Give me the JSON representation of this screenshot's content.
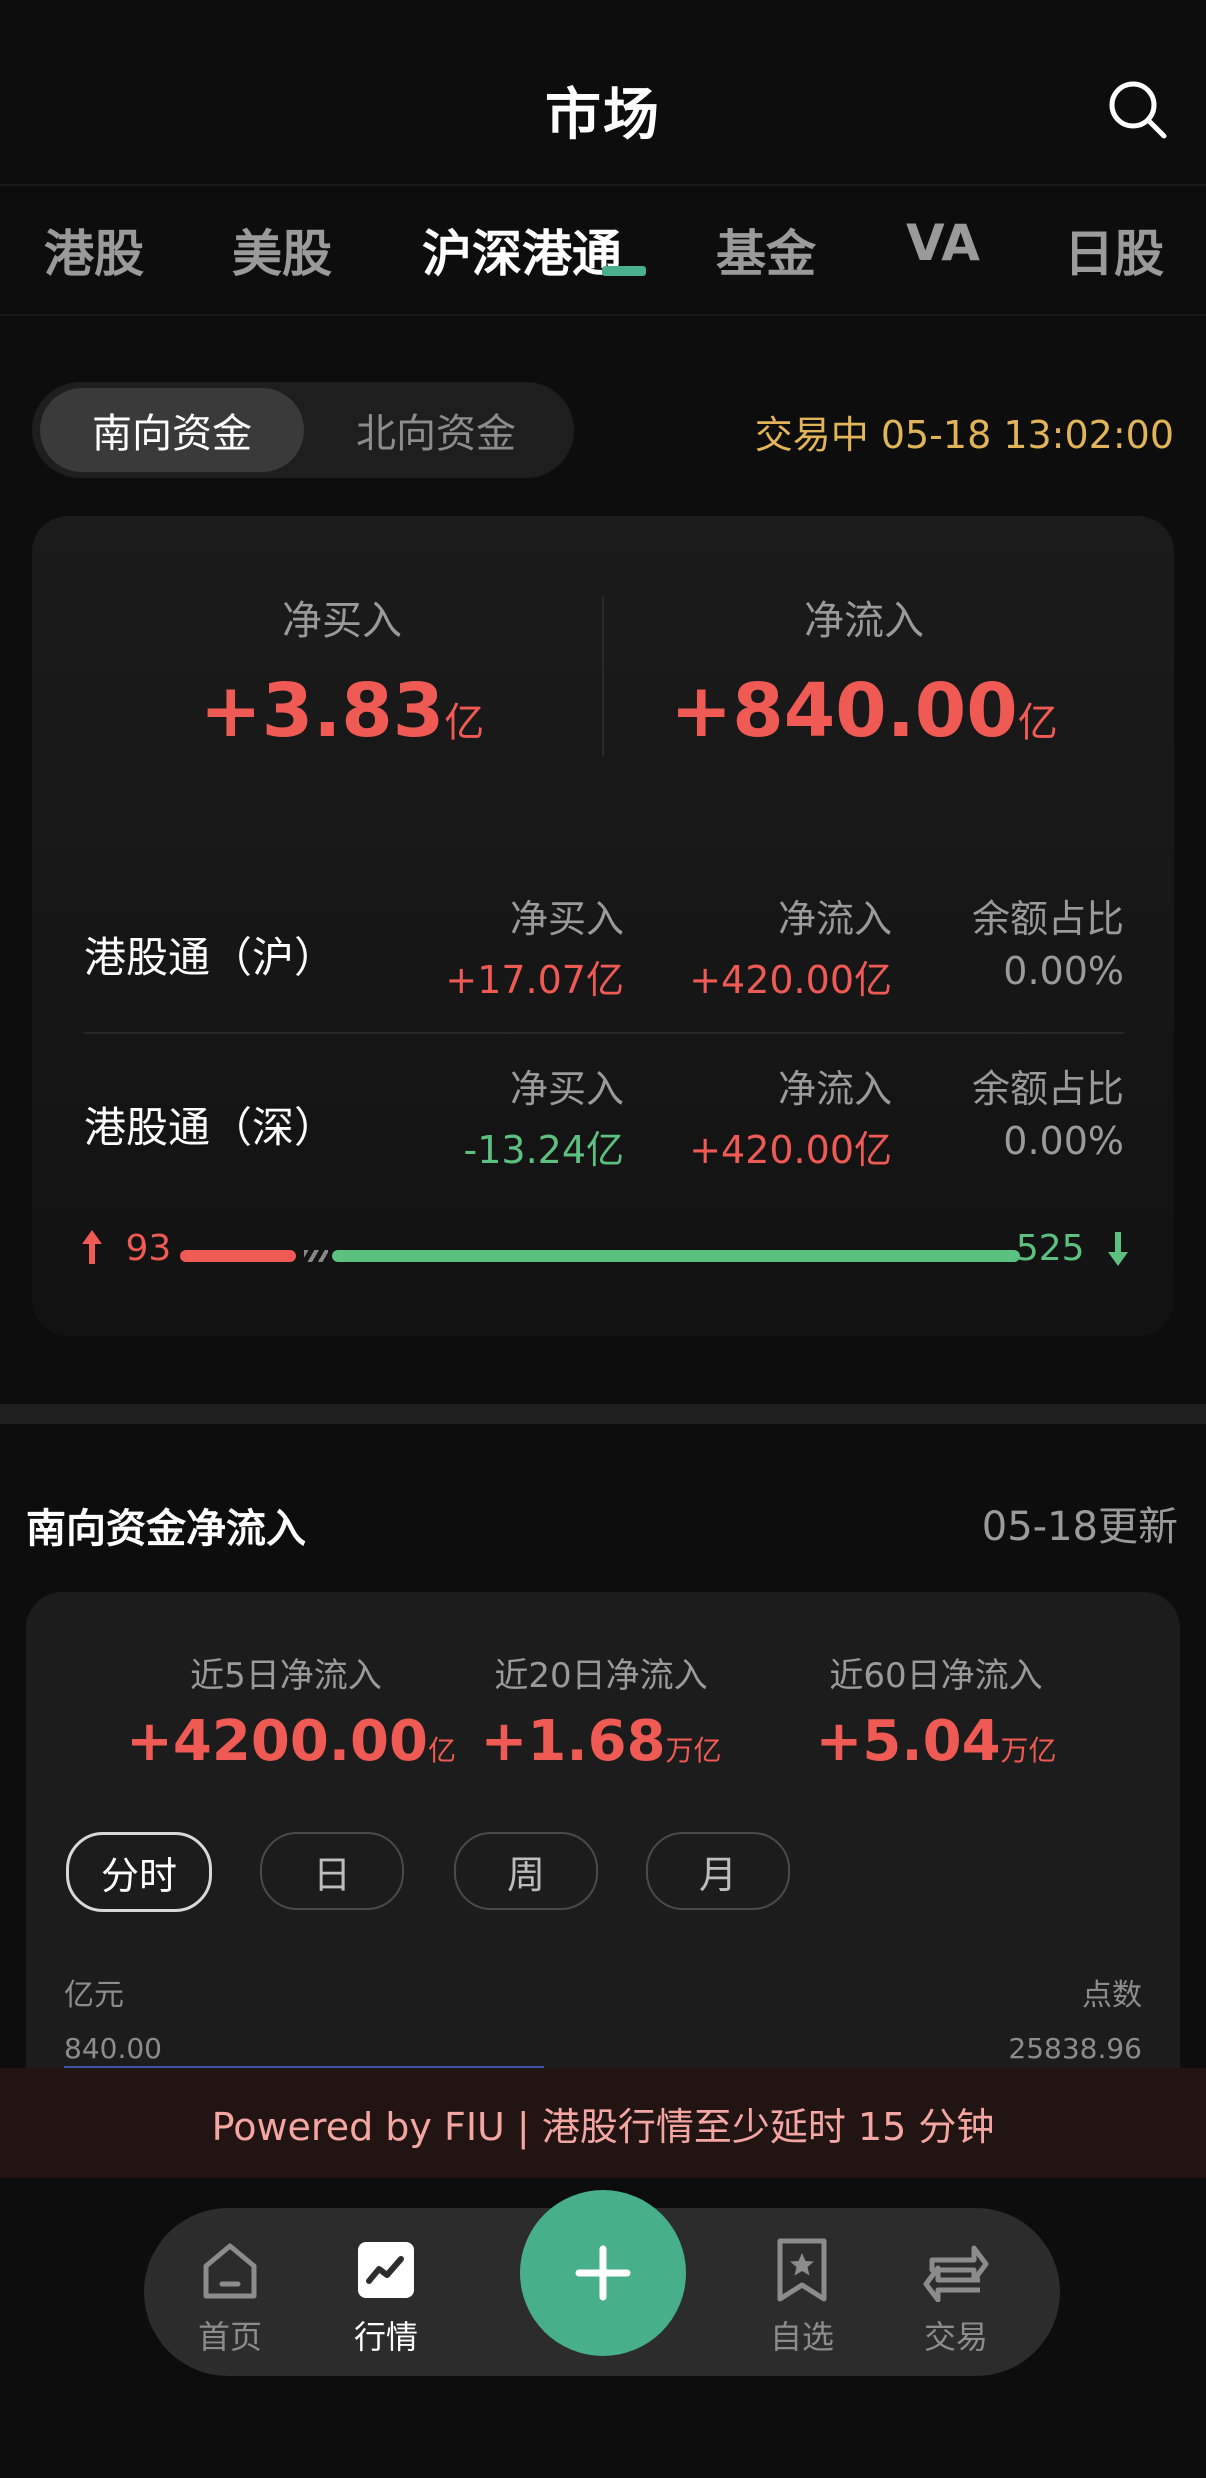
{
  "header": {
    "title": "市场"
  },
  "tabs": [
    {
      "label": "港股",
      "active": false
    },
    {
      "label": "美股",
      "active": false
    },
    {
      "label": "沪深港通",
      "active": true
    },
    {
      "label": "基金",
      "active": false
    },
    {
      "label": "VA",
      "active": false
    },
    {
      "label": "日股",
      "active": false
    }
  ],
  "segmented": {
    "options": [
      "南向资金",
      "北向资金"
    ],
    "selected": "南向资金"
  },
  "status": "交易中 05-18 13:02:00",
  "summary": {
    "net_buy": {
      "label": "净买入",
      "value": "+3.83",
      "unit": "亿"
    },
    "net_inflow": {
      "label": "净流入",
      "value": "+840.00",
      "unit": "亿"
    }
  },
  "rows": [
    {
      "name": "港股通（沪）",
      "net_buy_label": "净买入",
      "net_buy": "+17.07亿",
      "net_inflow_label": "净流入",
      "net_inflow": "+420.00亿",
      "ratio_label": "余额占比",
      "ratio": "0.00%"
    },
    {
      "name": "港股通（深）",
      "net_buy_label": "净买入",
      "net_buy": "-13.24亿",
      "net_inflow_label": "净流入",
      "net_inflow": "+420.00亿",
      "ratio_label": "余额占比",
      "ratio": "0.00%"
    }
  ],
  "breadth": {
    "up": "93",
    "down": "525"
  },
  "flow_section": {
    "title": "南向资金净流入",
    "update": "05-18更新",
    "stats": [
      {
        "label": "近5日净流入",
        "value": "+4200.00",
        "unit": "亿"
      },
      {
        "label": "近20日净流入",
        "value": "+1.68",
        "unit": "万亿"
      },
      {
        "label": "近60日净流入",
        "value": "+5.04",
        "unit": "万亿"
      }
    ],
    "periods": [
      "分时",
      "日",
      "周",
      "月"
    ],
    "selected_period": "分时",
    "axis": {
      "left_unit": "亿元",
      "right_unit": "点数",
      "left_value": "840.00",
      "right_value": "25838.96"
    }
  },
  "footer_notice": "Powered by FIU | 港股行情至少延时 15 分钟",
  "nav": {
    "items": [
      {
        "label": "首页",
        "active": false
      },
      {
        "label": "行情",
        "active": true
      },
      {
        "label": "自选",
        "active": false
      },
      {
        "label": "交易",
        "active": false
      }
    ]
  },
  "colors": {
    "up": "#ef5a55",
    "down": "#5cc081",
    "accent": "#47b08b",
    "status": "#e1b45a"
  }
}
